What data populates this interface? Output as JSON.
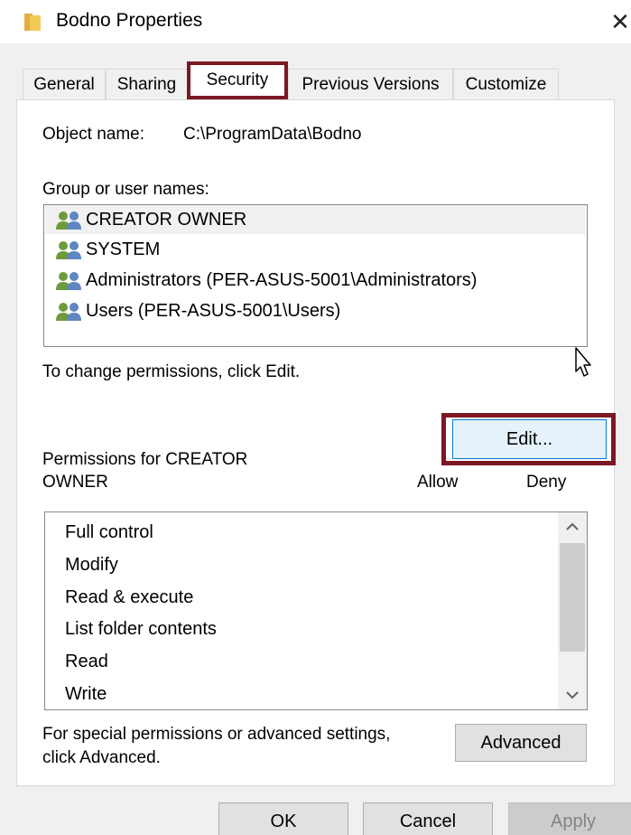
{
  "window": {
    "title": "Bodno Properties",
    "close_glyph": "✕"
  },
  "tabs": [
    {
      "label": "General",
      "selected": false
    },
    {
      "label": "Sharing",
      "selected": false
    },
    {
      "label": "Security",
      "selected": true
    },
    {
      "label": "Previous Versions",
      "selected": false
    },
    {
      "label": "Customize",
      "selected": false
    }
  ],
  "security": {
    "object_name_label": "Object name:",
    "object_name_value": "C:\\ProgramData\\Bodno",
    "group_label": "Group or user names:",
    "groups": [
      {
        "name": "CREATOR OWNER",
        "selected": true
      },
      {
        "name": "SYSTEM",
        "selected": false
      },
      {
        "name": "Administrators (PER-ASUS-5001\\Administrators)",
        "selected": false
      },
      {
        "name": "Users (PER-ASUS-5001\\Users)",
        "selected": false
      }
    ],
    "change_hint": "To change permissions, click Edit.",
    "edit_button": "Edit...",
    "permissions_label_line1": "Permissions for CREATOR",
    "permissions_label_line2": "OWNER",
    "allow_header": "Allow",
    "deny_header": "Deny",
    "permissions": [
      "Full control",
      "Modify",
      "Read & execute",
      "List folder contents",
      "Read",
      "Write"
    ],
    "advanced_hint_line1": "For special permissions or advanced settings,",
    "advanced_hint_line2": "click Advanced.",
    "advanced_button": "Advanced"
  },
  "footer": {
    "ok": "OK",
    "cancel": "Cancel",
    "apply": "Apply"
  },
  "colors": {
    "highlight": "#7d1724",
    "focus_border": "#0078d7",
    "dialog_bg": "#f0f0f0"
  },
  "icons": {
    "folder": "folder-icon",
    "users": "user-group-icon",
    "close": "close-icon",
    "scroll_up": "chevron-up-icon",
    "scroll_down": "chevron-down-icon",
    "cursor": "mouse-pointer-icon"
  }
}
